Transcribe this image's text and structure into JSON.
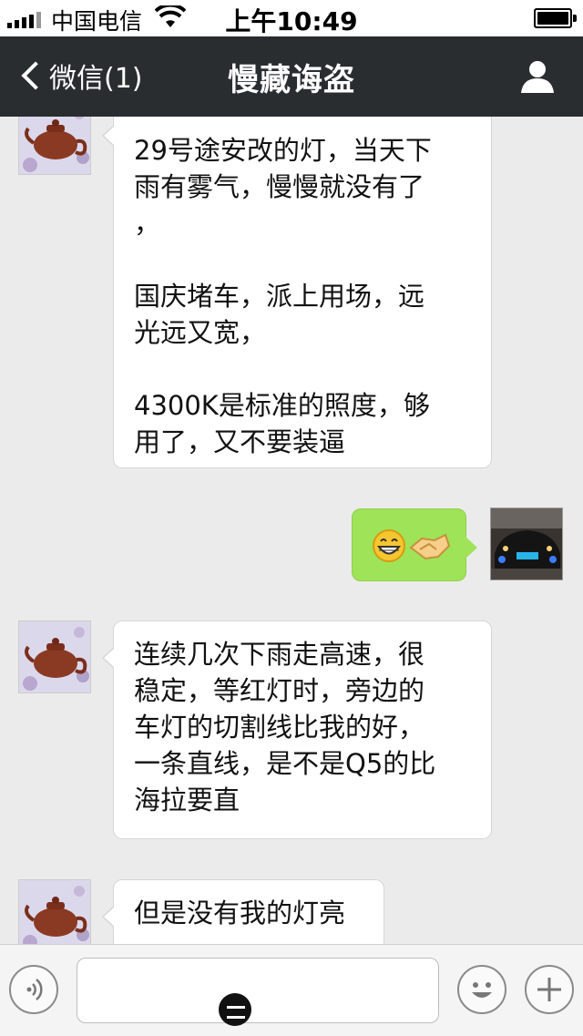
{
  "status_bar": {
    "carrier": "中国电信",
    "time": "上午10:49"
  },
  "nav": {
    "back_label": "微信(1)",
    "title": "慢藏诲盗"
  },
  "messages": [
    {
      "side": "left",
      "text": "29号途安改的灯，当天下\n雨有雾气，慢慢就没有了\n，\n\n国庆堵车，派上用场，远\n光远又宽，\n\n4300K是标准的照度，够\n用了，又不要装逼"
    },
    {
      "side": "right",
      "emojis": [
        "grin-emoji",
        "handshake-emoji"
      ]
    },
    {
      "side": "left",
      "text": "连续几次下雨走高速，很\n稳定，等红灯时，旁边的\n车灯的切割线比我的好，\n一条直线，是不是Q5的比\n海拉要直"
    },
    {
      "side": "left",
      "text": "但是没有我的灯亮"
    }
  ],
  "colors": {
    "navbar": "#2a2d30",
    "sent_bubble": "#9fe358",
    "background": "#ebebeb"
  }
}
